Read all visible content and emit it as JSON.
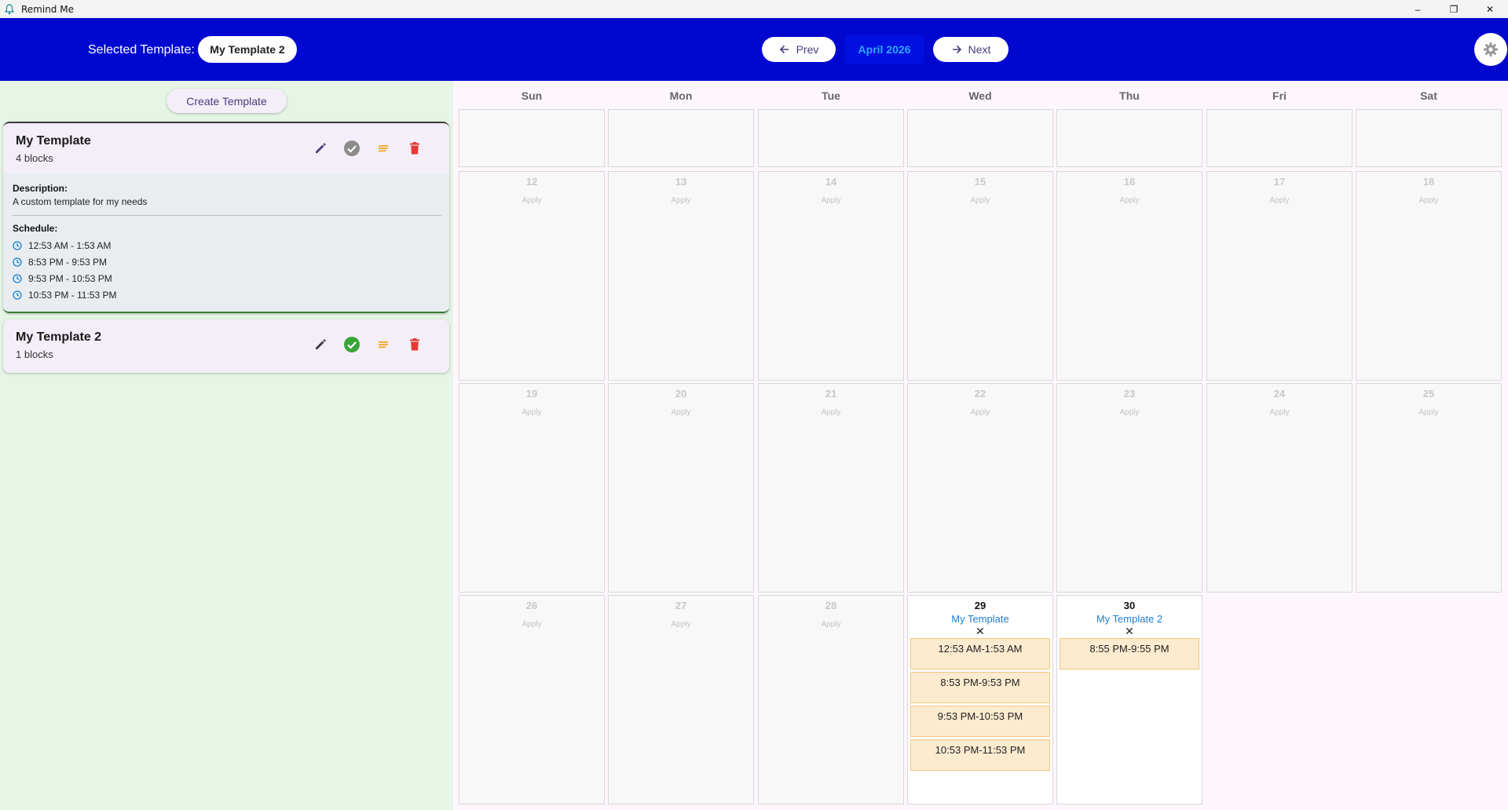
{
  "window": {
    "title": "Remind Me",
    "minimize_glyph": "–",
    "maximize_glyph": "❐",
    "close_glyph": "✕"
  },
  "header": {
    "selected_label": "Selected Template:",
    "selected_value": "My Template 2",
    "prev_label": "Prev",
    "next_label": "Next",
    "month": "April 2026"
  },
  "sidebar": {
    "create_label": "Create Template",
    "templates": [
      {
        "name": "My Template",
        "blocks": "4 blocks",
        "description_label": "Description:",
        "description": "A custom template for my needs",
        "schedule_label": "Schedule:",
        "schedule": [
          "12:53 AM - 1:53 AM",
          "8:53 PM - 9:53 PM",
          "9:53 PM - 10:53 PM",
          "10:53 PM - 11:53 PM"
        ],
        "selected": false
      },
      {
        "name": "My Template 2",
        "blocks": "1 blocks",
        "selected": true
      }
    ]
  },
  "calendar": {
    "weekdays": [
      "Sun",
      "Mon",
      "Tue",
      "Wed",
      "Thu",
      "Fri",
      "Sat"
    ],
    "apply_label": "Apply",
    "remove_glyph": "✕",
    "rows": [
      [
        {
          "day": ""
        },
        {
          "day": ""
        },
        {
          "day": ""
        },
        {
          "day": ""
        },
        {
          "day": ""
        },
        {
          "day": ""
        },
        {
          "day": ""
        }
      ],
      [
        {
          "day": "12"
        },
        {
          "day": "13"
        },
        {
          "day": "14"
        },
        {
          "day": "15"
        },
        {
          "day": "16"
        },
        {
          "day": "17"
        },
        {
          "day": "18"
        }
      ],
      [
        {
          "day": "19"
        },
        {
          "day": "20"
        },
        {
          "day": "21"
        },
        {
          "day": "22"
        },
        {
          "day": "23"
        },
        {
          "day": "24"
        },
        {
          "day": "25"
        }
      ],
      [
        {
          "day": "26"
        },
        {
          "day": "27"
        },
        {
          "day": "28"
        }
      ]
    ],
    "assigned": [
      {
        "day": "29",
        "template": "My Template",
        "blocks": [
          "12:53 AM-1:53 AM",
          "8:53 PM-9:53 PM",
          "9:53 PM-10:53 PM",
          "10:53 PM-11:53 PM"
        ]
      },
      {
        "day": "30",
        "template": "My Template 2",
        "blocks": [
          "8:55 PM-9:55 PM"
        ]
      }
    ]
  },
  "colors": {
    "header_bg": "#0008d0",
    "sidebar_bg": "#e6f5e6",
    "accent_purple": "#4b3c7a",
    "active_check": "#3aa53a",
    "inactive_check": "#8c8c8c",
    "delete_red": "#e53935",
    "list_orange": "#f5a623",
    "link_blue": "#1a7fd4",
    "block_bg": "#fdebd0"
  },
  "icons": {
    "app": "bell-people-icon",
    "prev": "arrow-left-icon",
    "next": "arrow-right-icon",
    "settings": "gear-icon",
    "edit": "pencil-icon",
    "select": "check-circle-icon",
    "details": "list-lines-icon",
    "delete": "trash-icon",
    "schedule_item": "clock-icon"
  }
}
